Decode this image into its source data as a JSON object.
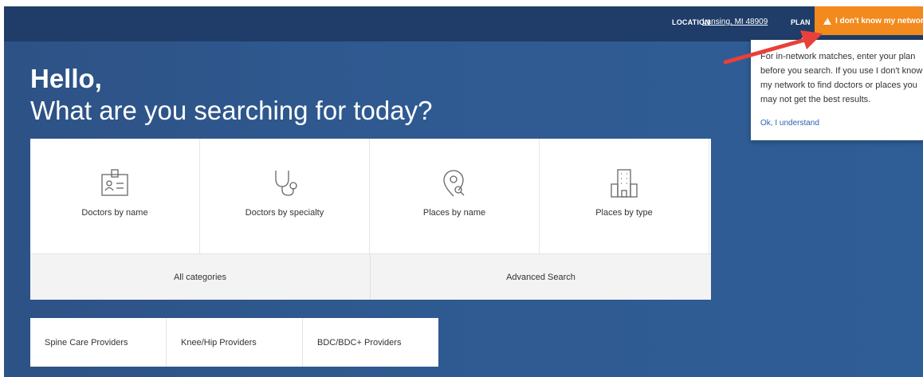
{
  "header": {
    "location_label": "LOCATION",
    "location_value": "Lansing, MI 48909",
    "plan_label": "PLAN",
    "network_button": "I don't know my network"
  },
  "popover": {
    "text": "For in-network matches, enter your plan before you search. If you use I don't know my network to find doctors or places you may not get the best results.",
    "link": "Ok, I understand"
  },
  "hero": {
    "greeting": "Hello,",
    "question": "What are you searching for today?"
  },
  "search_tiles": [
    {
      "label": "Doctors by name",
      "icon": "id-badge-icon"
    },
    {
      "label": "Doctors by specialty",
      "icon": "stethoscope-icon"
    },
    {
      "label": "Places by name",
      "icon": "location-search-icon"
    },
    {
      "label": "Places by type",
      "icon": "building-icon"
    }
  ],
  "bottom_links": {
    "all_categories": "All categories",
    "advanced_search": "Advanced Search"
  },
  "providers": [
    {
      "label": "Spine Care Providers"
    },
    {
      "label": "Knee/Hip Providers"
    },
    {
      "label": "BDC/BDC+ Providers"
    }
  ],
  "colors": {
    "background": "#2f5a91",
    "topbar": "#1f3d68",
    "network_button": "#f28a1e",
    "annotation_arrow": "#e8403a",
    "link": "#2c64b0"
  }
}
